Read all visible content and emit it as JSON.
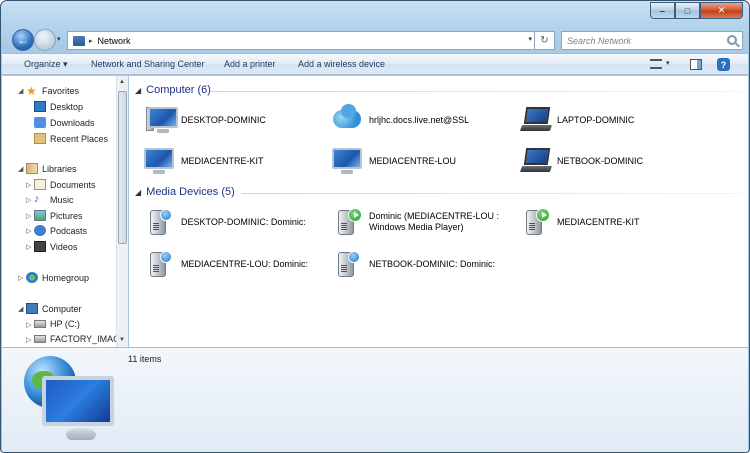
{
  "window": {
    "caption": {
      "minimize": "–",
      "maximize": "□",
      "close": "✕"
    }
  },
  "navigation": {
    "back_icon": "back-arrow-icon",
    "forward_icon": "forward-arrow-icon",
    "back_glyph": "←",
    "forward_glyph": "→",
    "address": {
      "separator": "▸",
      "location": "Network",
      "dropdown": "▾",
      "refresh": "↻"
    },
    "search": {
      "placeholder": "Search Network"
    }
  },
  "toolbar": {
    "organize": "Organize ▾",
    "network_sharing": "Network and Sharing Center",
    "add_printer": "Add a printer",
    "add_wireless": "Add a wireless device",
    "view_dropdown": "▾",
    "help": "?"
  },
  "nav_pane": {
    "favorites": {
      "label": "Favorites",
      "items": [
        "Desktop",
        "Downloads",
        "Recent Places"
      ]
    },
    "libraries": {
      "label": "Libraries",
      "items": [
        "Documents",
        "Music",
        "Pictures",
        "Podcasts",
        "Videos"
      ]
    },
    "homegroup": {
      "label": "Homegroup"
    },
    "computer": {
      "label": "Computer",
      "items": [
        "HP (C:)",
        "FACTORY_IMAGE"
      ]
    },
    "arrows": {
      "expanded": "◢",
      "collapsed": "▷"
    }
  },
  "content": {
    "groups": [
      {
        "header": "Computer (6)",
        "items": [
          {
            "label": "DESKTOP-DOMINIC",
            "icon": "desktop-computer-icon"
          },
          {
            "label": "hrljhc.docs.live.net@SSL",
            "icon": "skydrive-cloud-icon"
          },
          {
            "label": "LAPTOP-DOMINIC",
            "icon": "laptop-icon"
          },
          {
            "label": "MEDIACENTRE-KIT",
            "icon": "monitor-icon"
          },
          {
            "label": "MEDIACENTRE-LOU",
            "icon": "monitor-icon"
          },
          {
            "label": "NETBOOK-DOMINIC",
            "icon": "laptop-icon"
          }
        ]
      },
      {
        "header": "Media Devices (5)",
        "items": [
          {
            "label": "DESKTOP-DOMINIC: Dominic:",
            "icon": "media-server-icon"
          },
          {
            "label_line1": "Dominic (MEDIACENTRE-LOU :",
            "label_line2": "Windows Media Player)",
            "icon": "media-player-icon"
          },
          {
            "label": "MEDIACENTRE-KIT",
            "icon": "media-player-icon"
          },
          {
            "label": "MEDIACENTRE-LOU: Dominic:",
            "icon": "media-server-icon"
          },
          {
            "label": "NETBOOK-DOMINIC: Dominic:",
            "icon": "media-server-icon"
          }
        ]
      }
    ],
    "group_arrow": "◢"
  },
  "details": {
    "count": "11 items"
  },
  "colors": {
    "group_header": "#1e3287",
    "frame": "#9ec4e2",
    "toolbar": "#dde9f5"
  }
}
